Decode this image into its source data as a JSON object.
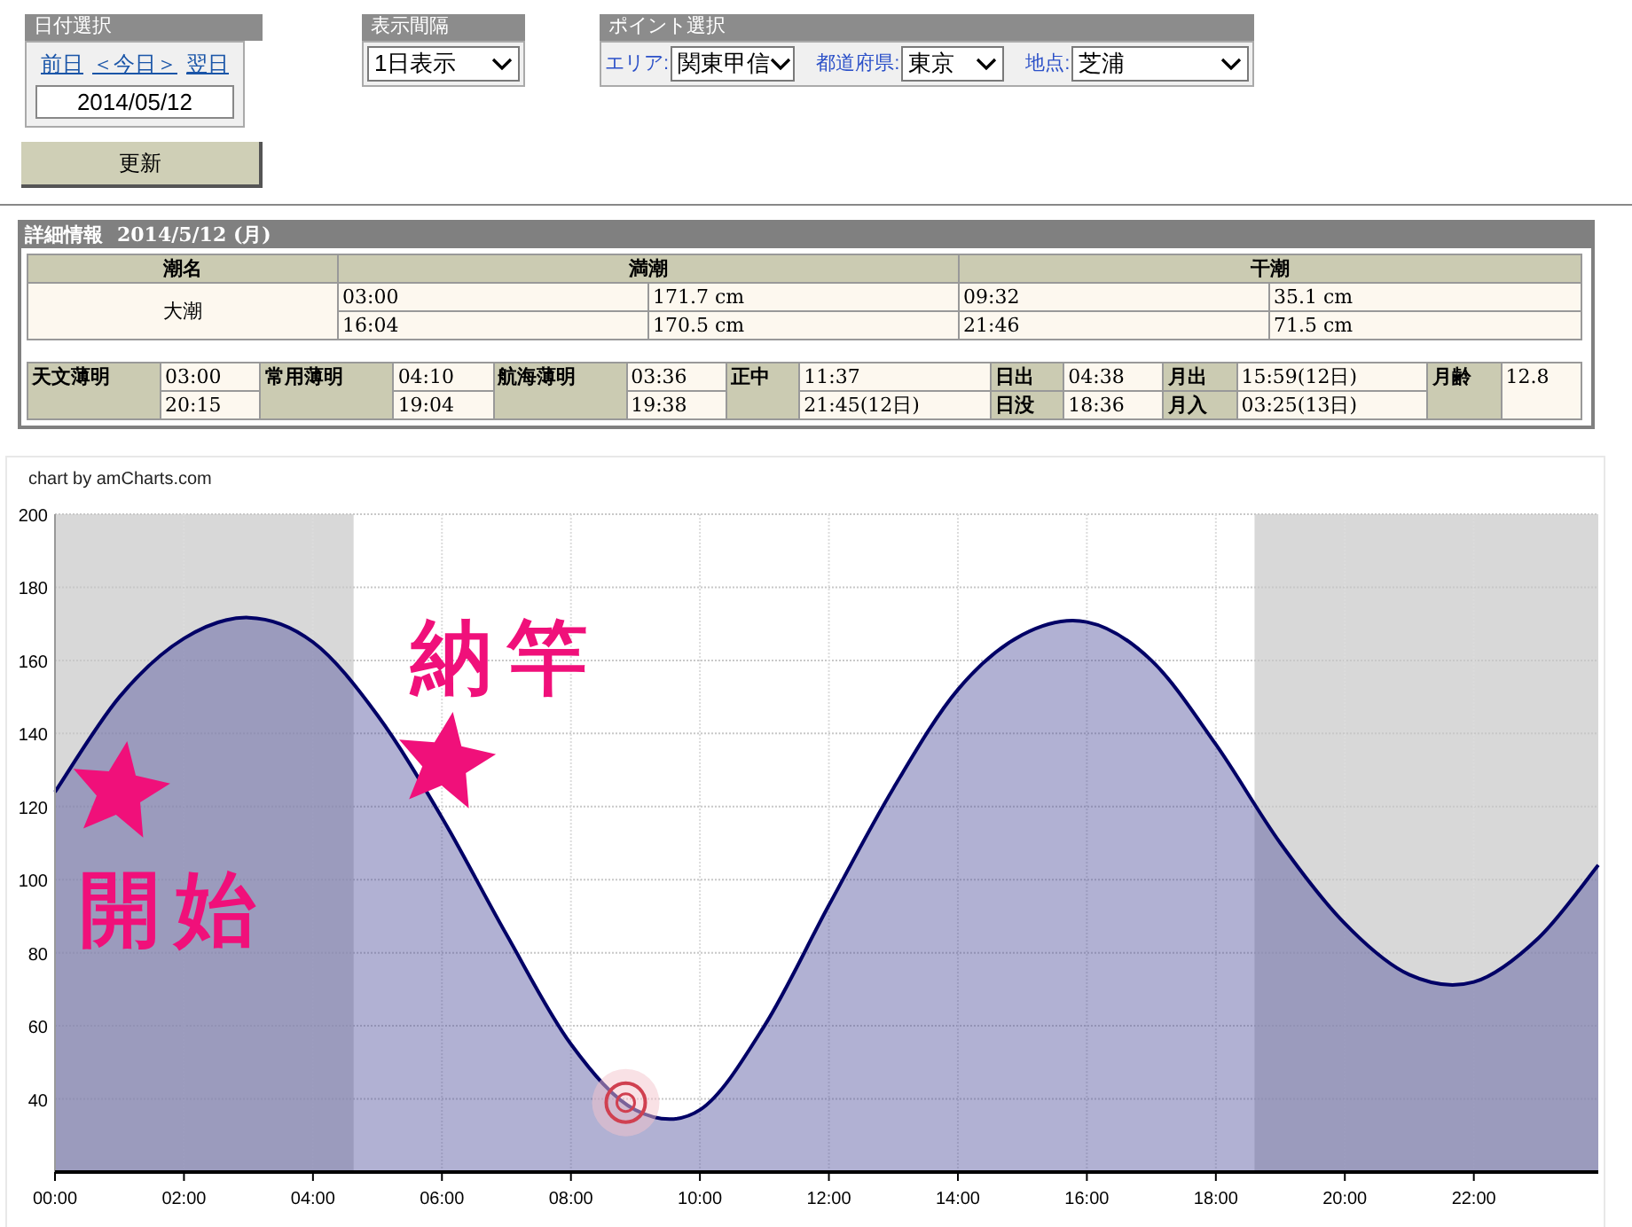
{
  "date_select": {
    "title": "日付選択",
    "links": [
      {
        "label": "前日"
      },
      {
        "label": "＜今日＞"
      },
      {
        "label": "翌日"
      }
    ],
    "date": "2014/05/12"
  },
  "update_button": "更新",
  "interval_select": {
    "title": "表示間隔",
    "value": "1日表示"
  },
  "point_select": {
    "title": "ポイント選択",
    "fields": [
      {
        "label": "エリア:",
        "value": "関東甲信"
      },
      {
        "label": "都道府県:",
        "value": "東京"
      },
      {
        "label": "地点:",
        "value": "芝浦"
      }
    ]
  },
  "details": {
    "title": "詳細情報",
    "date": "2014/5/12 (月)",
    "tide_table": {
      "columns": [
        "潮名",
        "満潮",
        "干潮"
      ],
      "tide_name": "大潮",
      "rows": [
        {
          "high_time": "03:00",
          "high_height": "171.7 cm",
          "low_time": "09:32",
          "low_height": "35.1 cm"
        },
        {
          "high_time": "16:04",
          "high_height": "170.5 cm",
          "low_time": "21:46",
          "low_height": "71.5 cm"
        }
      ]
    },
    "astro": [
      {
        "labels": [
          "天文薄明"
        ],
        "values": [
          "03:00",
          "20:15"
        ]
      },
      {
        "labels": [
          "常用薄明"
        ],
        "values": [
          "04:10",
          "19:04"
        ]
      },
      {
        "labels": [
          "航海薄明"
        ],
        "values": [
          "03:36",
          "19:38"
        ]
      },
      {
        "labels": [
          "正中"
        ],
        "values": [
          "11:37",
          "21:45(12日)"
        ]
      },
      {
        "labels": [
          "日出",
          "日没"
        ],
        "values": [
          "04:38",
          "18:36"
        ]
      },
      {
        "labels": [
          "月出",
          "月入"
        ],
        "values": [
          "15:59(12日)",
          "03:25(13日)"
        ]
      },
      {
        "labels": [
          "月齢"
        ],
        "values": [
          "12.8"
        ]
      }
    ]
  },
  "chart": {
    "credit": "chart by amCharts.com",
    "chart_data": {
      "type": "area",
      "x": [
        0,
        1,
        2,
        3,
        4,
        5,
        6,
        7,
        8,
        9,
        10,
        11,
        12,
        13,
        14,
        15,
        16,
        17,
        18,
        19,
        20,
        21,
        22,
        23,
        23.93
      ],
      "series": [
        {
          "color": "#000066",
          "values": [
            124,
            150,
            166,
            171.7,
            165,
            145,
            117,
            85,
            55,
            37,
            37,
            60,
            93,
            125,
            152,
            167,
            170.5,
            160,
            137,
            110,
            88,
            74,
            72,
            84,
            104
          ]
        }
      ],
      "xlim": [
        0,
        23.93
      ],
      "ylim": [
        20,
        200
      ],
      "xticks": [
        {
          "value": 0,
          "label": "00:00"
        },
        {
          "value": 2,
          "label": "02:00"
        },
        {
          "value": 4,
          "label": "04:00"
        },
        {
          "value": 6,
          "label": "06:00"
        },
        {
          "value": 8,
          "label": "08:00"
        },
        {
          "value": 10,
          "label": "10:00"
        },
        {
          "value": 12,
          "label": "12:00"
        },
        {
          "value": 14,
          "label": "14:00"
        },
        {
          "value": 16,
          "label": "16:00"
        },
        {
          "value": 18,
          "label": "18:00"
        },
        {
          "value": 20,
          "label": "20:00"
        },
        {
          "value": 22,
          "label": "22:00"
        }
      ],
      "yticks": [
        40,
        60,
        80,
        100,
        120,
        140,
        160,
        180,
        200
      ],
      "grid": true,
      "bands": [
        {
          "axis": "x",
          "from": 0,
          "to": 4.63
        },
        {
          "axis": "x",
          "from": 18.6,
          "to": 23.93
        }
      ]
    },
    "doodles": [
      {
        "kind": "marker"
      },
      {
        "kind": "star"
      },
      {
        "kind": "star"
      },
      {
        "kind": "text",
        "text": "開始"
      },
      {
        "kind": "text",
        "text": "納竿"
      }
    ]
  }
}
